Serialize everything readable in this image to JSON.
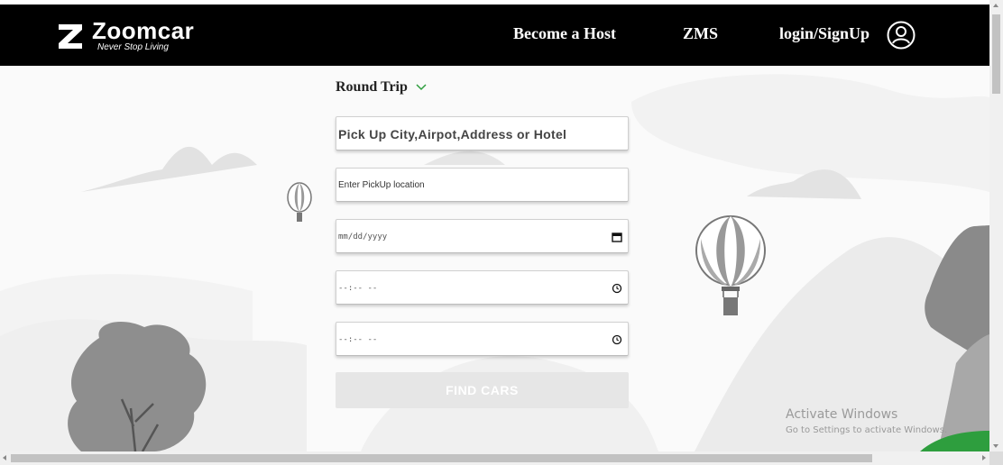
{
  "header": {
    "brand": "Zoomcar",
    "tagline": "Never Stop Living",
    "nav": {
      "become_host": "Become a Host",
      "zms": "ZMS",
      "login": "login/SignUp"
    }
  },
  "search_form": {
    "trip_type": "Round Trip",
    "city_placeholder": "Pick Up City,Airpot,Address or Hotel",
    "location_placeholder": "Enter PickUp location",
    "date_placeholder": "mm/dd/yyyy",
    "start_time_placeholder": "--:-- --",
    "end_time_placeholder": "--:-- --",
    "find_button": "FIND CARS"
  },
  "watermark": {
    "line1": "Activate Windows",
    "line2": "Go to Settings to activate Windows."
  },
  "colors": {
    "navbar_bg": "#000000",
    "accent_green": "#2e9e3e",
    "button_disabled": "#e6e6e6"
  },
  "icons": {
    "logo": "zoomcar-z-logo",
    "user": "user-circle-icon",
    "trip_toggle": "chevron-down-icon",
    "date": "calendar-icon",
    "time": "clock-icon"
  }
}
